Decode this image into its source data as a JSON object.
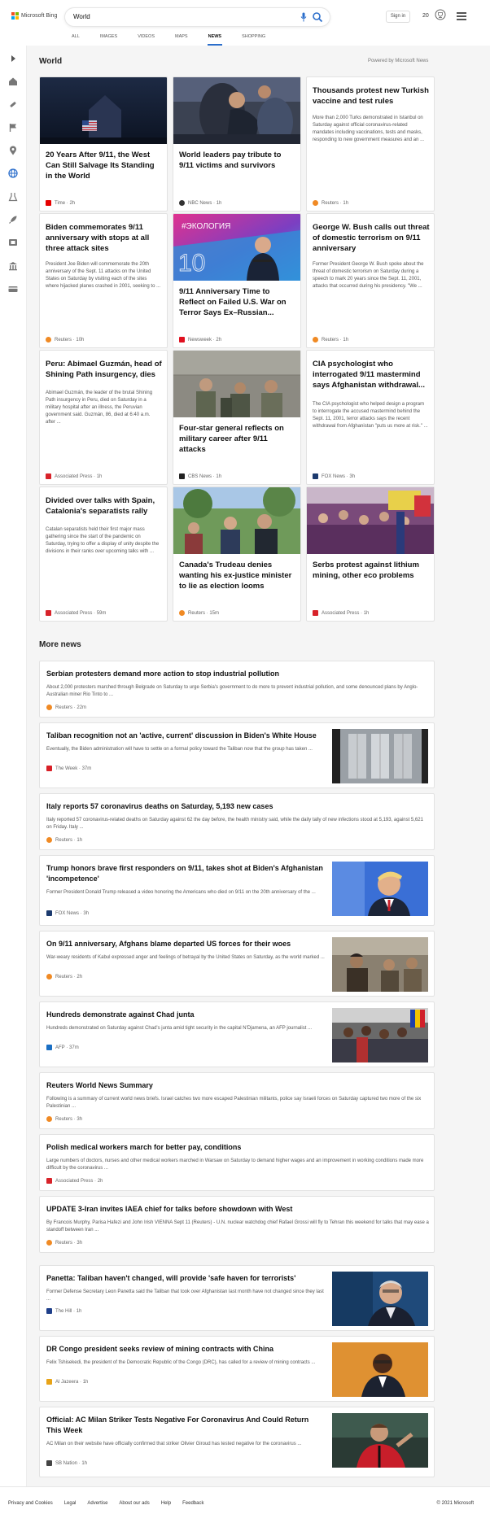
{
  "brand": {
    "name": "Microsoft Bing",
    "logo_colors": [
      "#f25022",
      "#7fba00",
      "#00a4ef",
      "#ffb900"
    ]
  },
  "search": {
    "value": "World"
  },
  "header": {
    "signin_label": "Sign in",
    "points": "20"
  },
  "nav": {
    "tabs": [
      "ALL",
      "IMAGES",
      "VIDEOS",
      "MAPS",
      "NEWS",
      "SHOPPING"
    ],
    "active": "NEWS"
  },
  "rail": {
    "icons": [
      "expand-icon",
      "home-icon",
      "medical-icon",
      "flag-icon",
      "pin-icon",
      "globe-icon",
      "science-icon",
      "rocket-icon",
      "film-icon",
      "building-icon",
      "money-icon"
    ]
  },
  "world": {
    "title": "World",
    "powered_by": "Powered by Microsoft News",
    "cards": [
      {
        "title": "20 Years After 9/11, the West Can Still Salvage Its Standing in the World",
        "body": "",
        "source": "Time",
        "age": "2h",
        "src_color": "#e60000",
        "image": "flag-night"
      },
      {
        "title": "World leaders pay tribute to 9/11 victims and survivors",
        "body": "",
        "source": "NBC News",
        "age": "1h",
        "src_color": "#333333",
        "image": "mourners"
      },
      {
        "title": "Thousands protest new Turkish vaccine and test rules",
        "body": "More than 2,000 Turks demonstrated in Istanbul on Saturday against official coronavirus-related mandates including vaccinations, tests and masks, responding to new government measures and an ...",
        "source": "Reuters",
        "age": "1h",
        "src_color": "#f08a24",
        "image": ""
      },
      {
        "title": "Biden commemorates 9/11 anniversary with stops at all three attack sites",
        "body": "President Joe Biden will commemorate the 20th anniversary of the Sept. 11 attacks on the United States on Saturday by visiting each of the sites where hijacked planes crashed in 2001, seeking to ...",
        "source": "Reuters",
        "age": "10h",
        "src_color": "#f08a24",
        "image": ""
      },
      {
        "title": "9/11 Anniversary Time to Reflect on Failed U.S. War on Terror Says Ex–Russian...",
        "body": "",
        "source": "Newsweek",
        "age": "2h",
        "src_color": "#e0101f",
        "image": "ecology",
        "img_text": "#ЭКОЛОГИЯ",
        "img_num": "10"
      },
      {
        "title": "George W. Bush calls out threat of domestic terrorism on 9/11 anniversary",
        "body": "Former President George W. Bush spoke about the threat of domestic terrorism on Saturday during a speech to mark 20 years since the Sept. 11, 2001, attacks that occurred during his presidency. \"We ...",
        "source": "Reuters",
        "age": "1h",
        "src_color": "#f08a24",
        "image": ""
      },
      {
        "title": "Peru: Abimael Guzmán, head of Shining Path insurgency, dies",
        "body": "Abimael Guzmán, the leader of the brutal Shining Path insurgency in Peru, died on Saturday in a military hospital after an illness, the Peruvian government said. Guzmán, 86, died at 6:40 a.m. after ...",
        "source": "Associated Press",
        "age": "1h",
        "src_color": "#d8232a",
        "image": ""
      },
      {
        "title": "Four-star general reflects on military career after 9/11 attacks",
        "body": "",
        "source": "CBS News",
        "age": "1h",
        "src_color": "#222222",
        "image": "soldiers"
      },
      {
        "title": "CIA psychologist who interrogated 9/11 mastermind says Afghanistan withdrawal...",
        "body": "The CIA psychologist who helped design a program to interrogate the accused mastermind behind the Sept. 11, 2001, terror attacks says the recent withdrawal from Afghanistan \"puts us more at risk.\" ...",
        "source": "FOX News",
        "age": "3h",
        "src_color": "#1c3a6e",
        "image": ""
      },
      {
        "title": "Divided over talks with Spain, Catalonia's separatists rally",
        "body": "Catalan separatists held their first major mass gathering since the start of the pandemic on Saturday, trying to offer a display of unity despite the divisions in their ranks over upcoming talks with ...",
        "source": "Associated Press",
        "age": "59m",
        "src_color": "#d8232a",
        "image": ""
      },
      {
        "title": "Canada's Trudeau denies wanting his ex-justice minister to lie as election looms",
        "body": "",
        "source": "Reuters",
        "age": "15m",
        "src_color": "#f08a24",
        "image": "trudeau"
      },
      {
        "title": "Serbs protest against lithium mining, other eco problems",
        "body": "",
        "source": "Associated Press",
        "age": "1h",
        "src_color": "#d8232a",
        "image": "protest"
      }
    ]
  },
  "more_news": {
    "title": "More news",
    "items": [
      {
        "title": "Serbian protesters demand more action to stop industrial pollution",
        "body": "About 2,000 protesters marched through Belgrade on Saturday to urge Serbia's government to do more to prevent industrial pollution, and some denounced plans by Anglo-Australian miner Rio Tinto to ...",
        "source": "Reuters",
        "age": "22m",
        "src_color": "#f08a24",
        "thumb": ""
      },
      {
        "title": "Taliban recognition not an 'active, current' discussion in Biden's White House",
        "body": "Eventually, the Biden administration will have to settle on a formal policy toward the Taliban now that the group has taken ...",
        "source": "The Week",
        "age": "37m",
        "src_color": "#d81f26",
        "thumb": "flags"
      },
      {
        "title": "Italy reports 57 coronavirus deaths on Saturday, 5,193 new cases",
        "body": "Italy reported 57 coronavirus-related deaths on Saturday against 62 the day before, the health ministry said, while the daily tally of new infections stood at 5,193, against 5,621 on Friday. Italy ...",
        "source": "Reuters",
        "age": "1h",
        "src_color": "#f08a24",
        "thumb": ""
      },
      {
        "title": "Trump honors brave first responders on 9/11, takes shot at Biden's Afghanistan 'incompetence'",
        "body": "Former President Donald Trump released a video honoring the Americans who died on 9/11 on the 20th anniversary of the ...",
        "source": "FOX News",
        "age": "3h",
        "src_color": "#1c3a6e",
        "thumb": "trump"
      },
      {
        "title": "On 9/11 anniversary, Afghans blame departed US forces for their woes",
        "body": "War-weary residents of Kabul expressed anger and feelings of betrayal by the United States on Saturday, as the world marked ...",
        "source": "Reuters",
        "age": "2h",
        "src_color": "#f08a24",
        "thumb": "kabul"
      },
      {
        "title": "Hundreds demonstrate against Chad junta",
        "body": "Hundreds demonstrated on Saturday against Chad's junta amid tight security in the capital N'Djamena, an AFP journalist ...",
        "source": "AFP",
        "age": "37m",
        "src_color": "#1a6fc4",
        "thumb": "chad"
      },
      {
        "title": "Reuters World News Summary",
        "body": "Following is a summary of current world news briefs. Israel catches two more escaped Palestinian militants, police say Israeli forces on Saturday captured two more of the six Palestinian ...",
        "source": "Reuters",
        "age": "3h",
        "src_color": "#f08a24",
        "thumb": ""
      },
      {
        "title": "Polish medical workers march for better pay, conditions",
        "body": "Large numbers of doctors, nurses and other medical workers marched in Warsaw on Saturday to demand higher wages and an improvement in working conditions made more difficult by the coronavirus ...",
        "source": "Associated Press",
        "age": "2h",
        "src_color": "#d8232a",
        "thumb": ""
      },
      {
        "title": "UPDATE 3-Iran invites IAEA chief for talks before showdown with West",
        "body": "By Francois Murphy, Parisa Hafezi and John Irish VIENNA Sept 11 (Reuters) - U.N. nuclear watchdog chief Rafael Grossi will fly to Tehran this weekend for talks that may ease a standoff between Iran ...",
        "source": "Reuters",
        "age": "3h",
        "src_color": "#f08a24",
        "thumb": ""
      },
      {
        "title": "Panetta: Taliban haven't changed, will provide 'safe haven for terrorists'",
        "body": "Former Defense Secretary Leon Panetta said the Taliban that took over Afghanistan last month have not changed since they last ...",
        "source": "The Hill",
        "age": "1h",
        "src_color": "#1f3f8a",
        "thumb": "panetta"
      },
      {
        "title": "DR Congo president seeks review of mining contracts with China",
        "body": "Felix Tshisekedi, the president of the Democratic Republic of the Congo (DRC), has called for a review of mining contracts ...",
        "source": "Al Jazeera",
        "age": "1h",
        "src_color": "#e8a317",
        "thumb": "congo"
      },
      {
        "title": "Official: AC Milan Striker Tests Negative For Coronavirus And Could Return This Week",
        "body": "AC Milan on their website have officially confirmed that striker Olivier Giroud has tested negative for the coronavirus ...",
        "source": "SB Nation",
        "age": "1h",
        "src_color": "#444444",
        "thumb": "giroud"
      }
    ]
  },
  "footer": {
    "links": [
      "Privacy and Cookies",
      "Legal",
      "Advertise",
      "About our ads",
      "Help",
      "Feedback"
    ],
    "copyright": "© 2021 Microsoft"
  },
  "colors": {
    "accent": "#2b6ecb",
    "background": "#f5f5f5"
  }
}
